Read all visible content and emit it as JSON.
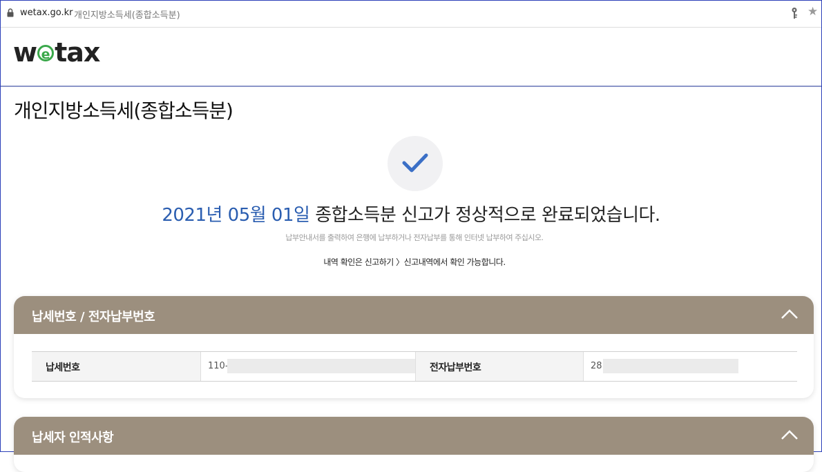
{
  "browser": {
    "domain": "wetax.go.kr",
    "tab_title": "개인지방소득세(종합소득분)"
  },
  "header": {
    "logo_pre": "w",
    "logo_e": "e",
    "logo_post": "tax"
  },
  "page": {
    "title": "개인지방소득세(종합소득분)"
  },
  "result": {
    "date": "2021년 05월 01일",
    "message": " 종합소득분 신고가 정상적으로 완료되었습니다.",
    "sub_message": "납부안내서를 출력하여 은행에 납부하거나 전자납부를 통해 인터넷 납부하여 주십시오.",
    "info_message": "내역 확인은 신고하기 〉신고내역에서 확인 가능합니다."
  },
  "panels": [
    {
      "title": "납세번호 / 전자납부번호",
      "rows": [
        {
          "label": "납세번호",
          "value": "110-"
        },
        {
          "label": "전자납부번호",
          "value": "28"
        }
      ]
    },
    {
      "title": "납세자 인적사항"
    }
  ],
  "colors": {
    "accent_blue": "#2a5db0",
    "panel_header": "#9c8f7e",
    "check": "#3b6fc6",
    "logo_green": "#3aa84a"
  }
}
